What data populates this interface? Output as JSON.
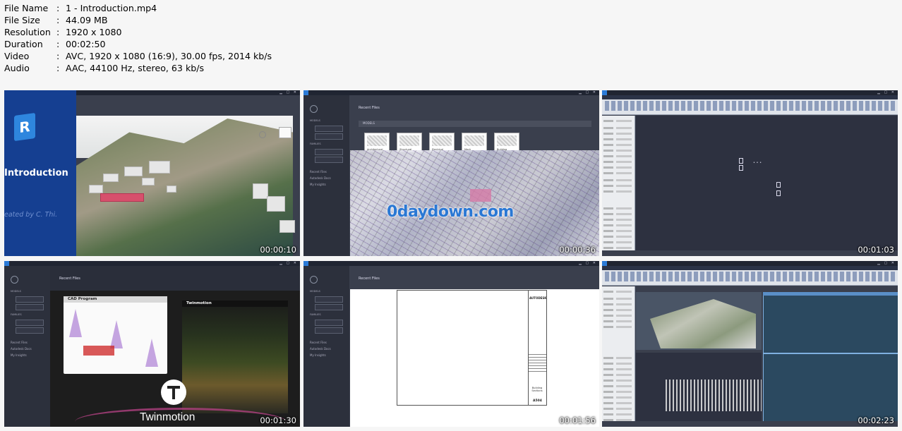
{
  "info": {
    "rows": [
      {
        "key": "File Name",
        "value": "1 - Introduction.mp4"
      },
      {
        "key": "File Size",
        "value": "44.09 MB"
      },
      {
        "key": "Resolution",
        "value": "1920 x 1080"
      },
      {
        "key": "Duration",
        "value": "00:02:50"
      },
      {
        "key": "Video",
        "value": "AVC, 1920 x 1080 (16:9), 30.00 fps, 2014 kb/s"
      },
      {
        "key": "Audio",
        "value": "AAC, 44100 Hz, stereo, 63 kb/s"
      }
    ],
    "separator": ":"
  },
  "thumbnails": [
    {
      "timestamp": "00:00:10",
      "logo_letter": "R",
      "title": "Introduction",
      "creator": "eated by C. Thi."
    },
    {
      "timestamp": "00:00:36",
      "heading": "Recent Files",
      "watermark": "0daydown.com"
    },
    {
      "timestamp": "00:01:03"
    },
    {
      "timestamp": "00:01:30",
      "heading": "Recent Files",
      "cad_title": "CAD Program",
      "tm_title": "Twinmotion",
      "tm_brand": "Twinmotion"
    },
    {
      "timestamp": "00:01:56",
      "heading": "Recent Files",
      "brand": "AUTODESK",
      "sheet_name": "Building Sections",
      "sheet_number": "A504"
    },
    {
      "timestamp": "00:02:23"
    }
  ],
  "colors": {
    "revit_blue": "#153f91",
    "accent": "#2e86de",
    "watermark": "#2a78d4"
  }
}
